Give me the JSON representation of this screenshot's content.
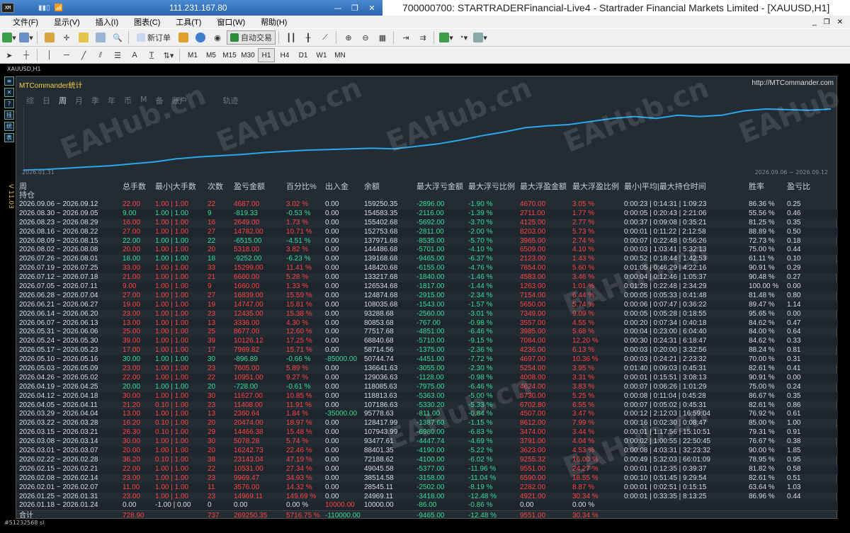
{
  "titlebar": {
    "server": "111.231.167.80",
    "window_title": "700000700: STARTRADERFinancial-Live4 - Startrader Financial Markets Limited - [XAUUSD,H1]",
    "logo": "XM"
  },
  "menu": [
    "文件(F)",
    "显示(V)",
    "插入(I)",
    "图表(C)",
    "工具(T)",
    "窗口(W)",
    "帮助(H)"
  ],
  "toolbar": {
    "new_order": "新订单",
    "auto_trade": "自动交易",
    "timeframes": [
      "M1",
      "M5",
      "M15",
      "M30",
      "H1",
      "H4",
      "D1",
      "W1",
      "MN"
    ],
    "text_tool": "A"
  },
  "chart": {
    "symbol_header": "XAUUSD,H1",
    "bottom_label": "#51232568 sl",
    "left_label": "V 11.03"
  },
  "panel": {
    "title": "MTCommander统计",
    "url": "http://MTCommander.com",
    "tabs": [
      "综",
      "日",
      "周",
      "月",
      "季",
      "年",
      "币",
      "M",
      "备",
      "账户",
      "轨迹"
    ],
    "equity_left": "2026.01.31",
    "equity_right": "2026.09.06 ~ 2026.09.12",
    "headers": {
      "period": "周",
      "hold": "持仓",
      "total": "总手数",
      "minmax": "最小|大手数",
      "count": "次数",
      "pnl": "盈亏金额",
      "pct": "百分比%",
      "flow": "出入金",
      "balance": "余额",
      "maxfl_amt": "最大浮亏金额",
      "maxfl_pct": "最大浮亏比例",
      "maxfp_amt": "最大浮盈金额",
      "maxfp_pct": "最大浮盈比例",
      "hold_time": "最小|平均|最大持仓时间",
      "winrate": "胜率",
      "pl_ratio": "盈亏比"
    },
    "rows": [
      [
        "2026.09.06 ~ 2026.09.12",
        "22.00",
        "1.00 | 1.00",
        "22",
        "4687.00",
        "3.02 %",
        "0.00",
        "159250.35",
        "-2896.00",
        "-1.90 %",
        "4670.00",
        "3.05 %",
        "0:00:23 | 0:14:31 | 1:09:23",
        "86.36 %",
        "0.25"
      ],
      [
        "2026.08.30 ~ 2026.09.05",
        "9.00",
        "1.00 | 1.00",
        "9",
        "-819.33",
        "-0.53 %",
        "0.00",
        "154583.35",
        "-2116.00",
        "-1.39 %",
        "2711.00",
        "1.77 %",
        "0:00:05 | 0:20:43 | 2:21:06",
        "55.56 %",
        "0.46"
      ],
      [
        "2026.08.23 ~ 2026.08.29",
        "16.00",
        "1.00 | 1.00",
        "16",
        "2649.00",
        "1.73 %",
        "0.00",
        "155402.68",
        "-5692.00",
        "-3.70 %",
        "4125.00",
        "2.77 %",
        "0:00:37 | 0:09:08 | 0:35:21",
        "81.25 %",
        "0.35"
      ],
      [
        "2026.08.16 ~ 2026.08.22",
        "27.00",
        "1.00 | 1.00",
        "27",
        "14782.00",
        "10.71 %",
        "0.00",
        "152753.68",
        "-2811.00",
        "-2.00 %",
        "8203.00",
        "5.73 %",
        "0:00:01 | 0:11:22 | 2:12:58",
        "88.89 %",
        "0.50"
      ],
      [
        "2026.08.09 ~ 2026.08.15",
        "22.00",
        "1.00 | 1.00",
        "22",
        "-6515.00",
        "-4.51 %",
        "0.00",
        "137971.68",
        "-8535.00",
        "-5.70 %",
        "3965.00",
        "2.74 %",
        "0:00:07 | 0:22:48 | 0:56:26",
        "72.73 %",
        "0.18"
      ],
      [
        "2026.08.02 ~ 2026.08.08",
        "20.00",
        "1.00 | 1.00",
        "20",
        "5318.00",
        "3.82 %",
        "0.00",
        "144486.68",
        "-5701.00",
        "-4.10 %",
        "6509.00",
        "4.10 %",
        "0:00:03 | 1:03:41 | 5:32:13",
        "75.00 %",
        "0.44"
      ],
      [
        "2026.07.26 ~ 2026.08.01",
        "18.00",
        "1.00 | 1.00",
        "18",
        "-9252.00",
        "-6.23 %",
        "0.00",
        "139168.68",
        "-9465.00",
        "-6.37 %",
        "2123.00",
        "1.43 %",
        "0:00:52 | 0:18:44 | 1:42:53",
        "61.11 %",
        "0.10"
      ],
      [
        "2026.07.19 ~ 2026.07.25",
        "33.00",
        "1.00 | 1.00",
        "33",
        "15299.00",
        "11.41 %",
        "0.00",
        "148420.68",
        "-6155.00",
        "-4.76 %",
        "7854.00",
        "5.60 %",
        "0:01:05 | 0:46:29 | 4:22:16",
        "90.91 %",
        "0.29"
      ],
      [
        "2026.07.12 ~ 2026.07.18",
        "21.00",
        "1.00 | 1.00",
        "21",
        "6660.00",
        "5.28 %",
        "0.00",
        "133217.68",
        "-1840.00",
        "-1.46 %",
        "4583.00",
        "3.46 %",
        "0:00:04 | 0:12:46 | 1:05:37",
        "90.48 %",
        "0.27"
      ],
      [
        "2026.07.05 ~ 2026.07.11",
        "9.00",
        "1.00 | 1.00",
        "9",
        "1660.00",
        "1.33 %",
        "0.00",
        "126534.68",
        "-1817.00",
        "-1.44 %",
        "1263.00",
        "1.01 %",
        "0:01:28 | 0:22:48 | 2:34:29",
        "100.00 %",
        "0.00"
      ],
      [
        "2026.06.28 ~ 2026.07.04",
        "27.00",
        "1.00 | 1.00",
        "27",
        "16839.00",
        "15.59 %",
        "0.00",
        "124874.68",
        "-2915.00",
        "-2.34 %",
        "7154.00",
        "6.44 %",
        "0:00:05 | 0:05:33 | 0:41:48",
        "81.48 %",
        "0.80"
      ],
      [
        "2026.06.21 ~ 2026.06.27",
        "19.00",
        "1.00 | 1.00",
        "19",
        "14747.00",
        "15.81 %",
        "0.00",
        "108035.68",
        "-1543.00",
        "-1.57 %",
        "5650.00",
        "5.74 %",
        "0:00:06 | 0:07:47 | 0:36:22",
        "89.47 %",
        "1.14"
      ],
      [
        "2026.06.14 ~ 2026.06.20",
        "23.00",
        "1.00 | 1.00",
        "23",
        "12435.00",
        "15.38 %",
        "0.00",
        "93288.68",
        "-2560.00",
        "-3.01 %",
        "7349.00",
        "9.09 %",
        "0:00:05 | 0:05:28 | 0:18:55",
        "95.65 %",
        "0.00"
      ],
      [
        "2026.06.07 ~ 2026.06.13",
        "13.00",
        "1.00 | 1.00",
        "13",
        "3336.00",
        "4.30 %",
        "0.00",
        "80853.68",
        "-767.00",
        "-0.98 %",
        "3557.00",
        "4.55 %",
        "0:00:20 | 0:07:34 | 0:40:18",
        "84.62 %",
        "0.47"
      ],
      [
        "2026.05.31 ~ 2026.06.06",
        "25.00",
        "1.00 | 1.00",
        "25",
        "8677.00",
        "12.60 %",
        "0.00",
        "77517.68",
        "-4851.00",
        "-6.46 %",
        "3985.00",
        "5.68 %",
        "0:00:04 | 0:23:00 | 6:04:40",
        "84.00 %",
        "0.64"
      ],
      [
        "2026.05.24 ~ 2026.05.30",
        "39.00",
        "1.00 | 1.00",
        "39",
        "10126.12",
        "17.25 %",
        "0.00",
        "68840.68",
        "-5710.00",
        "-9.15 %",
        "7084.00",
        "12.20 %",
        "0:00:30 | 0:24:31 | 6:18:47",
        "84.62 %",
        "0.33"
      ],
      [
        "2026.05.17 ~ 2026.05.23",
        "17.00",
        "1.00 | 1.00",
        "17",
        "7969.82",
        "15.71 %",
        "0.00",
        "58714.56",
        "-1375.00",
        "-2.36 %",
        "4236.00",
        "6.13 %",
        "0:00:03 | 0:20:00 | 3:32:56",
        "88.24 %",
        "0.81"
      ],
      [
        "2026.05.10 ~ 2026.05.16",
        "30.00",
        "1.00 | 1.00",
        "30",
        "-896.89",
        "-0.66 %",
        "-85000.00",
        "50744.74",
        "-4451.00",
        "-7.72 %",
        "4697.00",
        "10.36 %",
        "0:00:03 | 0:24:21 | 2:23:32",
        "70.00 %",
        "0.31"
      ],
      [
        "2026.05.03 ~ 2026.05.09",
        "23.00",
        "1.00 | 1.00",
        "23",
        "7605.00",
        "5.89 %",
        "0.00",
        "136641.63",
        "-3055.00",
        "-2.30 %",
        "5254.00",
        "3.95 %",
        "0:01:40 | 0:09:03 | 0:45:31",
        "82.61 %",
        "0.41"
      ],
      [
        "2026.04.26 ~ 2026.05.02",
        "22.00",
        "1.00 | 1.00",
        "22",
        "10951.00",
        "9.27 %",
        "0.00",
        "129036.63",
        "-1128.00",
        "-0.98 %",
        "4008.00",
        "3.31 %",
        "0:00:01 | 0:15:51 | 3:08:13",
        "90.91 %",
        "0.00"
      ],
      [
        "2026.04.19 ~ 2026.04.25",
        "20.00",
        "1.00 | 1.00",
        "20",
        "-728.00",
        "-0.61 %",
        "0.00",
        "118085.63",
        "-7975.00",
        "-6.46 %",
        "4624.00",
        "3.83 %",
        "0:00:07 | 0:06:26 | 1:01:29",
        "75.00 %",
        "0.24"
      ],
      [
        "2026.04.12 ~ 2026.04.18",
        "30.00",
        "1.00 | 1.00",
        "30",
        "11627.00",
        "10.85 %",
        "0.00",
        "118813.63",
        "-5363.00",
        "-5.00 %",
        "5730.00",
        "5.25 %",
        "0:00:08 | 0:11:04 | 0:45:28",
        "86.67 %",
        "0.35"
      ],
      [
        "2026.04.05 ~ 2026.04.11",
        "21.20",
        "0.10 | 1.00",
        "23",
        "11408.00",
        "11.91 %",
        "0.00",
        "107186.63",
        "-5330.20",
        "-5.33 %",
        "6702.80",
        "6.55 %",
        "0:00:07 | 0:05:02 | 0:45:31",
        "82.61 %",
        "0.86"
      ],
      [
        "2026.03.29 ~ 2026.04.04",
        "13.00",
        "1.00 | 1.00",
        "13",
        "2360.64",
        "1.84 %",
        "-35000.00",
        "95778.63",
        "-811.00",
        "-0.84 %",
        "4507.00",
        "3.47 %",
        "0:00:12 | 2:12:03 | 16:59:04",
        "76.92 %",
        "0.61"
      ],
      [
        "2026.03.22 ~ 2026.03.28",
        "16.20",
        "0.10 | 1.00",
        "20",
        "20474.00",
        "18.97 %",
        "0.00",
        "128417.99",
        "-1387.60",
        "-1.15 %",
        "8612.00",
        "7.99 %",
        "0:00:16 | 0:02:30 | 0:08:47",
        "85.00 %",
        "1.00"
      ],
      [
        "2026.03.15 ~ 2026.03.21",
        "26.30",
        "0.10 | 1.00",
        "29",
        "14466.38",
        "15.48 %",
        "0.00",
        "107943.99",
        "-6980.00",
        "-6.83 %",
        "3474.00",
        "3.44 %",
        "0:00:01 | 1:17:56 | 15:10:51",
        "79.31 %",
        "0.91"
      ],
      [
        "2026.03.08 ~ 2026.03.14",
        "30.00",
        "1.00 | 1.00",
        "30",
        "5078.28",
        "5.74 %",
        "0.00",
        "93477.61",
        "-4447.74",
        "-4.69 %",
        "3791.00",
        "4.04 %",
        "0:00:02 | 1:00:55 | 22:50:45",
        "76.67 %",
        "0.38"
      ],
      [
        "2026.03.01 ~ 2026.03.07",
        "20.00",
        "1.00 | 1.00",
        "20",
        "16242.73",
        "22.46 %",
        "0.00",
        "88401.35",
        "-4190.00",
        "-5.22 %",
        "3623.00",
        "4.53 %",
        "0:00:08 | 4:03:31 | 32:23:32",
        "90.00 %",
        "1.85"
      ],
      [
        "2026.02.22 ~ 2026.02.28",
        "36.20",
        "0.10 | 1.00",
        "38",
        "23143.04",
        "47.19 %",
        "0.00",
        "72188.62",
        "-4100.00",
        "-6.02 %",
        "9255.32",
        "16.00 %",
        "0:00:49 | 5:32:03 | 66:01:09",
        "78.95 %",
        "0.95"
      ],
      [
        "2026.02.15 ~ 2026.02.21",
        "22.00",
        "1.00 | 1.00",
        "22",
        "10531.00",
        "27.34 %",
        "0.00",
        "49045.58",
        "-5377.00",
        "-11.96 %",
        "9551.00",
        "24.27 %",
        "0:00:01 | 0:12:35 | 0:39:37",
        "81.82 %",
        "0.58"
      ],
      [
        "2026.02.08 ~ 2026.02.14",
        "23.00",
        "1.00 | 1.00",
        "23",
        "9969.47",
        "34.93 %",
        "0.00",
        "38514.58",
        "-3158.00",
        "-11.04 %",
        "6590.00",
        "18.55 %",
        "0:00:10 | 0:51:45 | 9:29:54",
        "82.61 %",
        "0.51"
      ],
      [
        "2026.02.01 ~ 2026.02.07",
        "11.00",
        "1.00 | 1.00",
        "11",
        "3576.00",
        "14.32 %",
        "0.00",
        "28545.11",
        "-2502.00",
        "-8.19 %",
        "2282.00",
        "8.87 %",
        "0:00:01 | 0:02:51 | 0:15:15",
        "63.64 %",
        "1.03"
      ],
      [
        "2026.01.25 ~ 2026.01.31",
        "23.00",
        "1.00 | 1.00",
        "23",
        "14969.11",
        "149.69 %",
        "0.00",
        "24969.11",
        "-3418.00",
        "-12.48 %",
        "4921.00",
        "30.34 %",
        "0:00:01 | 0:33:35 | 8:13:25",
        "86.96 %",
        "0.44"
      ],
      [
        "2026.01.18 ~ 2026.01.24",
        "0.00",
        "-1.00 | 0.00",
        "0",
        "0.00",
        "0.00 %",
        "10000.00",
        "10000.00",
        "-86.00",
        "-0.86 %",
        "0.00",
        "0.00 %",
        "",
        "",
        ""
      ]
    ],
    "total": {
      "label": "合计",
      "lots": "728.90",
      "count": "737",
      "pnl": "269250.35",
      "pct": "5716.75 %",
      "flow": "-110000.00",
      "maxfl_amt": "-9465.00",
      "maxfl_pct": "-12.48 %",
      "maxfp_amt": "9551.00",
      "maxfp_pct": "30.34 %"
    },
    "equity_curve": [
      0.02,
      0.03,
      0.05,
      0.07,
      0.09,
      0.12,
      0.15,
      0.2,
      0.23,
      0.25,
      0.27,
      0.3,
      0.32,
      0.34,
      0.35,
      0.36,
      0.37,
      0.36,
      0.4,
      0.44,
      0.5,
      0.57,
      0.63,
      0.7,
      0.73,
      0.75,
      0.8,
      0.85,
      0.88,
      0.85,
      0.9,
      0.88,
      0.9,
      0.97,
      1.0,
      0.99,
      0.98,
      1.0
    ]
  },
  "colors": {
    "win": "#ff4444",
    "loss": "#33dd99",
    "curve": "#2aa7e8",
    "title": "#f2d245"
  }
}
